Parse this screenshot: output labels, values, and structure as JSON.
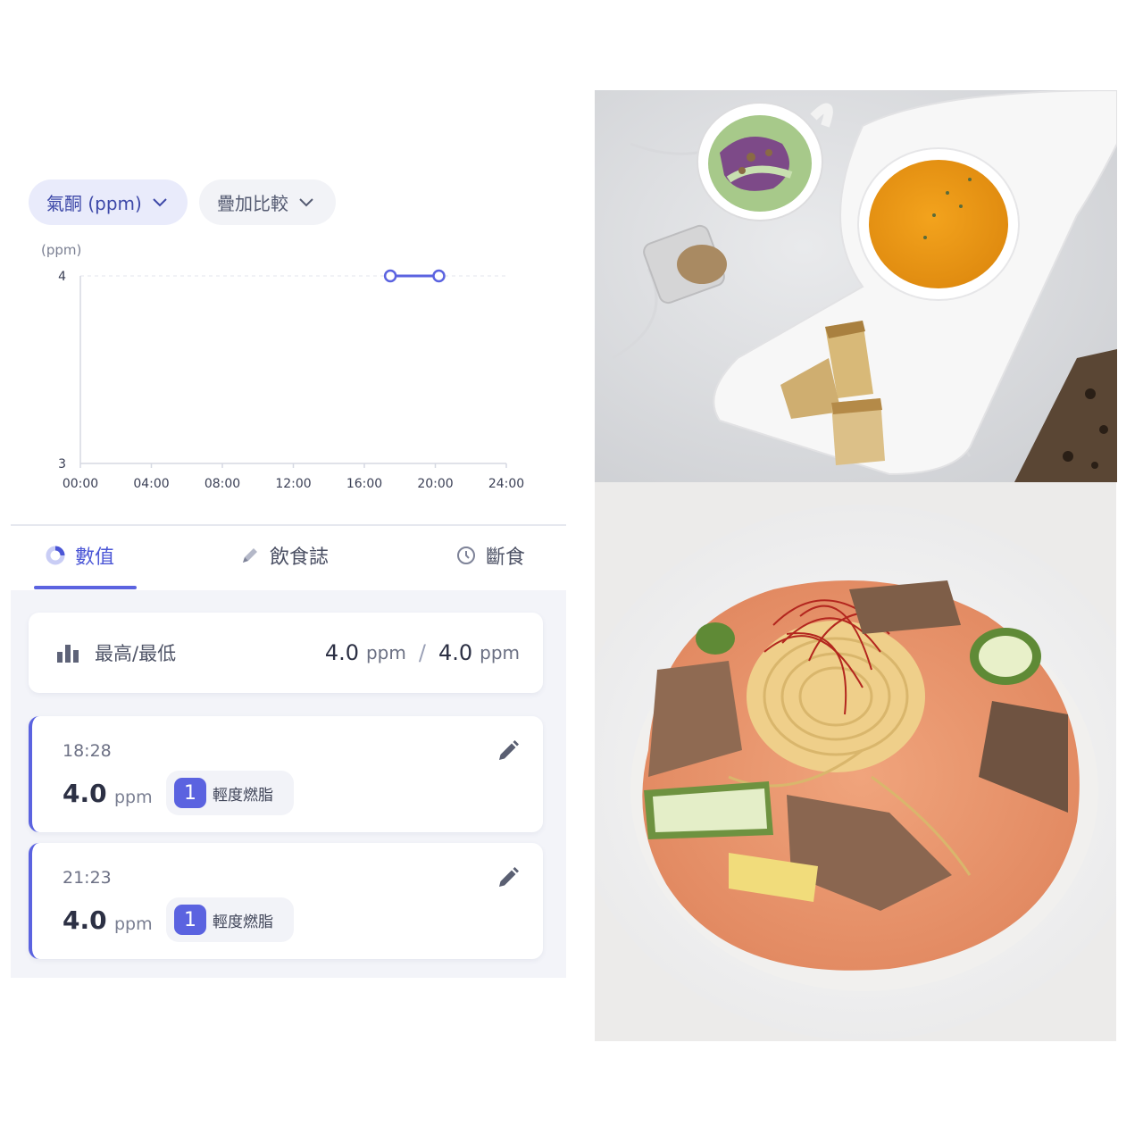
{
  "filters": {
    "metric_label": "氣酮 (ppm)",
    "compare_label": "疊加比較"
  },
  "chart_data": {
    "type": "line",
    "unit_label": "(ppm)",
    "x_ticks": [
      "00:00",
      "04:00",
      "08:00",
      "12:00",
      "16:00",
      "20:00",
      "24:00"
    ],
    "y_ticks": [
      "4",
      "3"
    ],
    "xlim_hours": [
      0,
      24
    ],
    "ylim": [
      3,
      4
    ],
    "grid": "dashed line at y = 4",
    "series": [
      {
        "color": "#5b63e0",
        "points": [
          {
            "x": "17:28",
            "y": 4.0
          },
          {
            "x": "20:12",
            "y": 4.0
          }
        ]
      }
    ]
  },
  "tabs": [
    {
      "label": "數值",
      "icon": "donut-icon",
      "active": true
    },
    {
      "label": "飲食誌",
      "icon": "pencil-icon",
      "active": false
    },
    {
      "label": "斷食",
      "icon": "clock-icon",
      "active": false
    }
  ],
  "summary": {
    "label": "最高/最低",
    "max_value": "4.0",
    "min_value": "4.0",
    "unit": "ppm",
    "separator": "/"
  },
  "entries": [
    {
      "time": "18:28",
      "value": "4.0",
      "unit": "ppm",
      "level": "1",
      "level_label": "輕度燃脂"
    },
    {
      "time": "21:23",
      "value": "4.0",
      "unit": "ppm",
      "level": "1",
      "level_label": "輕度燃脂"
    }
  ],
  "colors": {
    "accent": "#5b63e0",
    "accent_soft": "#e9ebfb",
    "list_background": "#f3f4f9"
  },
  "photos": [
    {
      "subject": "salad, pumpkin soup and toast on white plate"
    },
    {
      "subject": "tomato cream pasta with grilled meat and zucchini"
    }
  ]
}
